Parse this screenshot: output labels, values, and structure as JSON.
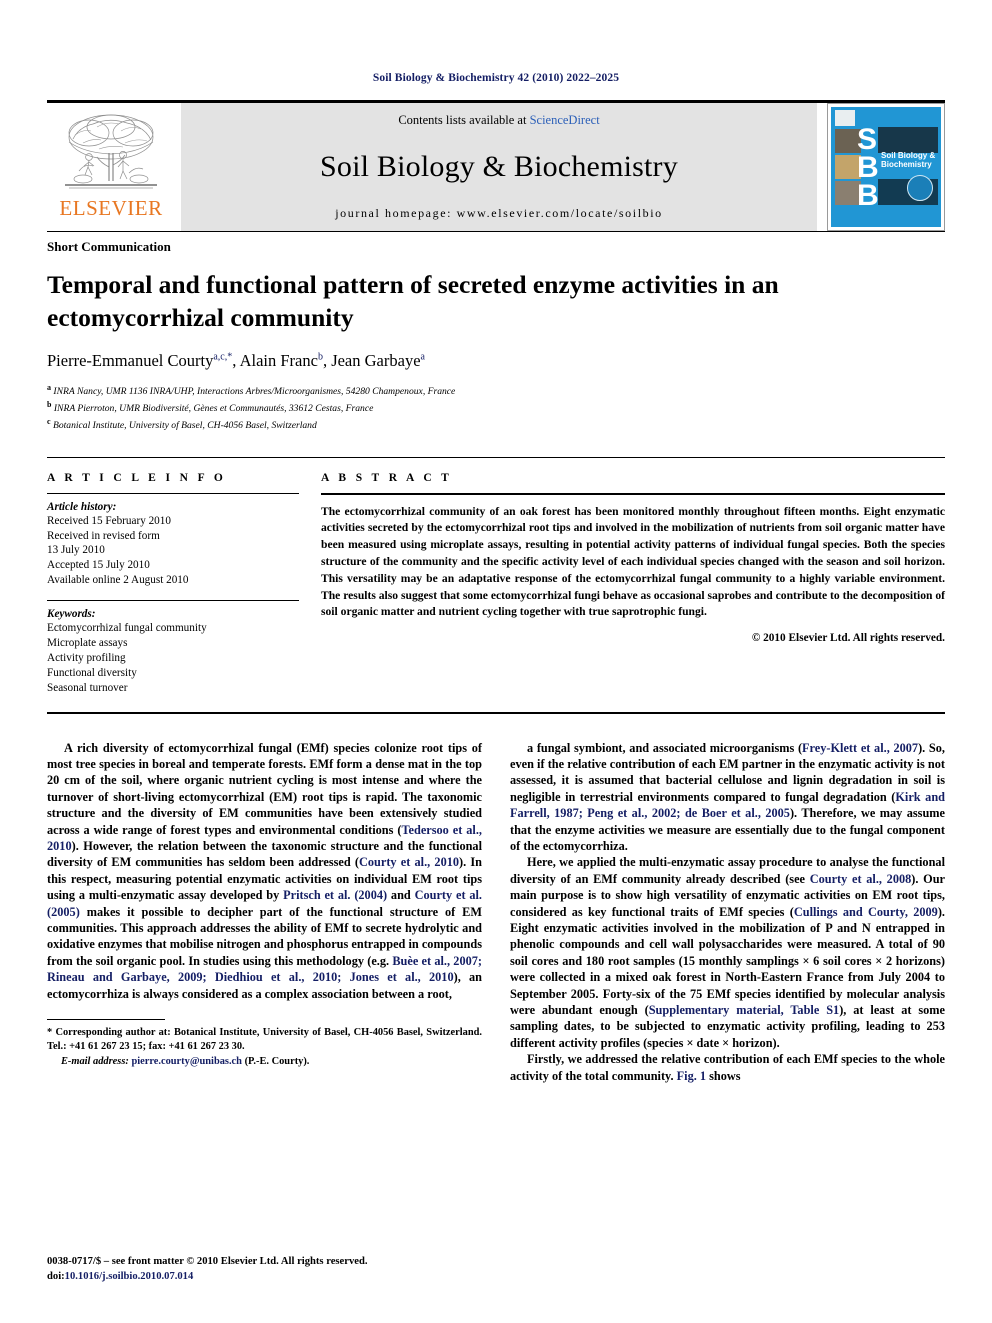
{
  "running_head": "Soil Biology & Biochemistry 42 (2010) 2022–2025",
  "masthead": {
    "publisher_name": "ELSEVIER",
    "contents_prefix": "Contents lists available at ",
    "sciencedirect": "ScienceDirect",
    "journal_title": "Soil Biology & Biochemistry",
    "homepage": "journal homepage: www.elsevier.com/locate/soilbio",
    "cover": {
      "letters": [
        "S",
        "B",
        "B"
      ],
      "journal_name": "Soil Biology & Biochemistry",
      "background_color": "#2196d4"
    },
    "accent_orange": "#e87722",
    "link_blue": "#2b5fb8"
  },
  "article": {
    "section_type": "Short Communication",
    "title": "Temporal and functional pattern of secreted enzyme activities in an ectomycorrhizal community",
    "authors_html": "Pierre-Emmanuel Courty",
    "authors": [
      {
        "name": "Pierre-Emmanuel Courty",
        "marks": "a,c,*"
      },
      {
        "name": "Alain Franc",
        "marks": "b"
      },
      {
        "name": "Jean Garbaye",
        "marks": "a"
      }
    ],
    "affiliations": [
      {
        "mark": "a",
        "text": "INRA Nancy, UMR 1136 INRA/UHP, Interactions Arbres/Microorganismes, 54280 Champenoux, France"
      },
      {
        "mark": "b",
        "text": "INRA Pierroton, UMR Biodiversité, Gènes et Communautés, 33612 Cestas, France"
      },
      {
        "mark": "c",
        "text": "Botanical Institute, University of Basel, CH-4056 Basel, Switzerland"
      }
    ]
  },
  "article_info": {
    "heading": "A R T I C L E    I N F O",
    "history_label": "Article history:",
    "history": [
      "Received 15 February 2010",
      "Received in revised form",
      "13 July 2010",
      "Accepted 15 July 2010",
      "Available online 2 August 2010"
    ],
    "keywords_label": "Keywords:",
    "keywords": [
      "Ectomycorrhizal fungal community",
      "Microplate assays",
      "Activity profiling",
      "Functional diversity",
      "Seasonal turnover"
    ]
  },
  "abstract": {
    "heading": "A B S T R A C T",
    "text": "The ectomycorrhizal community of an oak forest has been monitored monthly throughout fifteen months. Eight enzymatic activities secreted by the ectomycorrhizal root tips and involved in the mobilization of nutrients from soil organic matter have been measured using microplate assays, resulting in potential activity patterns of individual fungal species. Both the species structure of the community and the specific activity level of each individual species changed with the season and soil horizon. This versatility may be an adaptative response of the ectomycorrhizal fungal community to a highly variable environment. The results also suggest that some ectomycorrhizal fungi behave as occasional saprobes and contribute to the decomposition of soil organic matter and nutrient cycling together with true saprotrophic fungi.",
    "copyright": "© 2010 Elsevier Ltd. All rights reserved."
  },
  "body": {
    "left_column": [
      {
        "segments": [
          {
            "t": "A rich diversity of ectomycorrhizal fungal (EMf) species colonize root tips of most tree species in boreal and temperate forests. EMf form a dense mat in the top 20 cm of the soil, where organic nutrient cycling is most intense and where the turnover of short-living ectomycorrhizal (EM) root tips is rapid. The taxonomic structure and the diversity of EM communities have been extensively studied across a wide range of forest types and environmental conditions (",
            "cite": false
          },
          {
            "t": "Tedersoo et al., 2010",
            "cite": true
          },
          {
            "t": "). However, the relation between the taxonomic structure and the functional diversity of EM communities has seldom been addressed (",
            "cite": false
          },
          {
            "t": "Courty et al., 2010",
            "cite": true
          },
          {
            "t": "). In this respect, measuring potential enzymatic activities on individual EM root tips using a multi-enzymatic assay developed by ",
            "cite": false
          },
          {
            "t": "Pritsch et al. (2004)",
            "cite": true
          },
          {
            "t": " and ",
            "cite": false
          },
          {
            "t": "Courty et al. (2005)",
            "cite": true
          },
          {
            "t": " makes it possible to decipher part of the functional structure of EM communities. This approach addresses the ability of EMf to secrete hydrolytic and oxidative enzymes that mobilise nitrogen and phosphorus entrapped in compounds from the soil organic pool. In studies using this methodology (e.g. ",
            "cite": false
          },
          {
            "t": "Buèe et al., 2007; Rineau and Garbaye, 2009; Diedhiou et al., 2010; Jones et al., 2010",
            "cite": true
          },
          {
            "t": "), an ectomycorrhiza is always considered as a complex association between a root,",
            "cite": false
          }
        ]
      }
    ],
    "right_column": [
      {
        "segments": [
          {
            "t": "a fungal symbiont, and associated microorganisms (",
            "cite": false
          },
          {
            "t": "Frey-Klett et al., 2007",
            "cite": true
          },
          {
            "t": "). So, even if the relative contribution of each EM partner in the enzymatic activity is not assessed, it is assumed that bacterial cellulose and lignin degradation in soil is negligible in terrestrial environments compared to fungal degradation (",
            "cite": false
          },
          {
            "t": "Kirk and Farrell, 1987; Peng et al., 2002; de Boer et al., 2005",
            "cite": true
          },
          {
            "t": "). Therefore, we may assume that the enzyme activities we measure are essentially due to the fungal component of the ectomycorrhiza.",
            "cite": false
          }
        ]
      },
      {
        "segments": [
          {
            "t": "Here, we applied the multi-enzymatic assay procedure to analyse the functional diversity of an EMf community already described (see ",
            "cite": false
          },
          {
            "t": "Courty et al., 2008",
            "cite": true
          },
          {
            "t": "). Our main purpose is to show high versatility of enzymatic activities on EM root tips, considered as key functional traits of EMf species (",
            "cite": false
          },
          {
            "t": "Cullings and Courty, 2009",
            "cite": true
          },
          {
            "t": "). Eight enzymatic activities involved in the mobilization of P and N entrapped in phenolic compounds and cell wall polysaccharides were measured. A total of 90 soil cores and 180 root samples (15 monthly samplings × 6 soil cores × 2 horizons) were collected in a mixed oak forest in North-Eastern France from July 2004 to September 2005. Forty-six of the 75 EMf species identified by molecular analysis were abundant enough (",
            "cite": false
          },
          {
            "t": "Supplementary material, Table S1",
            "cite": true
          },
          {
            "t": "), at least at some sampling dates, to be subjected to enzymatic activity profiling, leading to 253 different activity profiles (species × date × horizon).",
            "cite": false
          }
        ]
      },
      {
        "segments": [
          {
            "t": "Firstly, we addressed the relative contribution of each EMf species to the whole activity of the total community. ",
            "cite": false
          },
          {
            "t": "Fig. 1",
            "cite": true
          },
          {
            "t": " shows",
            "cite": false
          }
        ]
      }
    ]
  },
  "footnote": {
    "corresponding": "* Corresponding author at: Botanical Institute, University of Basel, CH-4056 Basel, Switzerland. Tel.: +41 61 267 23 15; fax: +41 61 267 23 30.",
    "email_label": "E-mail address:",
    "email": "pierre.courty@unibas.ch",
    "email_suffix": "(P.-E. Courty)."
  },
  "page_footer": {
    "front_matter": "0038-0717/$ – see front matter © 2010 Elsevier Ltd. All rights reserved.",
    "doi_label": "doi:",
    "doi": "10.1016/j.soilbio.2010.07.014"
  }
}
